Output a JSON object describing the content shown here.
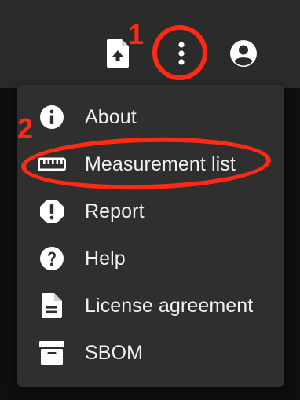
{
  "topbar": {
    "upload_icon": "file-upload-icon",
    "more_icon": "more-vert-icon",
    "account_icon": "account-circle-icon"
  },
  "menu": {
    "items": [
      {
        "label": "About",
        "icon": "info-icon"
      },
      {
        "label": "Measurement list",
        "icon": "ruler-icon"
      },
      {
        "label": "Report",
        "icon": "report-icon"
      },
      {
        "label": "Help",
        "icon": "help-icon"
      },
      {
        "label": "License agreement",
        "icon": "document-icon"
      },
      {
        "label": "SBOM",
        "icon": "archive-icon"
      }
    ]
  },
  "annotations": {
    "step1": "1",
    "step2": "2",
    "color": "#ff2a14"
  },
  "colors": {
    "topbar": "#2b2b2b",
    "menu_bg": "#2f2f2f",
    "text": "#f2f2f2"
  }
}
